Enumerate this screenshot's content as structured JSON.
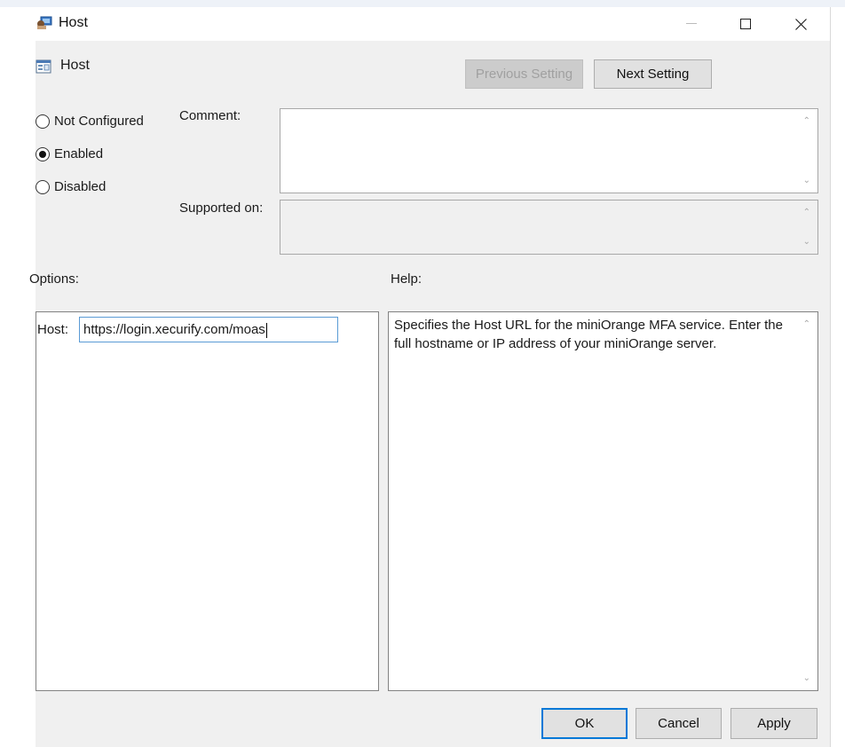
{
  "window": {
    "title": "Host"
  },
  "policy": {
    "name": "Host"
  },
  "nav": {
    "previous_label": "Previous Setting",
    "next_label": "Next Setting"
  },
  "state": {
    "options": [
      {
        "label": "Not Configured",
        "selected": false
      },
      {
        "label": "Enabled",
        "selected": true
      },
      {
        "label": "Disabled",
        "selected": false
      }
    ]
  },
  "comment": {
    "label": "Comment:",
    "value": ""
  },
  "supported": {
    "label": "Supported on:",
    "value": ""
  },
  "options_section": {
    "label": "Options:",
    "host_label": "Host:",
    "host_value": "https://login.xecurify.com/moas"
  },
  "help_section": {
    "label": "Help:",
    "text": "Specifies the Host URL for the miniOrange MFA service. Enter the full hostname or IP address of your miniOrange server."
  },
  "footer": {
    "ok_label": "OK",
    "cancel_label": "Cancel",
    "apply_label": "Apply"
  },
  "colors": {
    "accent": "#0078d7",
    "window_bg": "#f0f0f0",
    "panel_border": "#828282"
  }
}
